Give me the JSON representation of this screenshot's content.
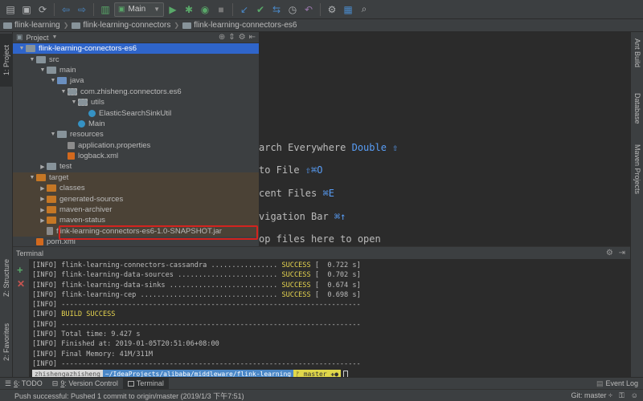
{
  "toolbar": {
    "run_config": "Main",
    "icons": [
      "open-icon",
      "save-icon",
      "sync-icon",
      "back-icon",
      "forward-icon",
      "build-icon",
      "run-icon",
      "debug-icon",
      "coverage-icon",
      "stop-icon",
      "vcs-update-icon",
      "vcs-commit-icon",
      "vcs-compare-icon",
      "vcs-history-icon",
      "vcs-revert-icon",
      "settings-icon",
      "project-structure-icon",
      "search-icon"
    ]
  },
  "breadcrumb": {
    "items": [
      "flink-learning",
      "flink-learning-connectors",
      "flink-learning-connectors-es6"
    ]
  },
  "left_tabs": {
    "project": "1: Project",
    "structure": "Z: Structure",
    "favorites": "2: Favorites"
  },
  "right_tabs": {
    "ant": "Ant Build",
    "database": "Database",
    "maven": "Maven Projects"
  },
  "project_panel": {
    "title": "Project",
    "tree": [
      {
        "label": "flink-learning-connectors-es6",
        "level": 0,
        "icon": "folder",
        "open": true,
        "selected": true
      },
      {
        "label": "src",
        "level": 1,
        "icon": "folder",
        "open": true
      },
      {
        "label": "main",
        "level": 2,
        "icon": "folder",
        "open": true
      },
      {
        "label": "java",
        "level": 3,
        "icon": "src",
        "open": true
      },
      {
        "label": "com.zhisheng.connectors.es6",
        "level": 4,
        "icon": "pkg",
        "open": true
      },
      {
        "label": "utils",
        "level": 5,
        "icon": "pkg",
        "open": true
      },
      {
        "label": "ElasticSearchSinkUtil",
        "level": 6,
        "icon": "cls",
        "leaf": true
      },
      {
        "label": "Main",
        "level": 5,
        "icon": "cls",
        "leaf": true
      },
      {
        "label": "resources",
        "level": 3,
        "icon": "folder",
        "open": true
      },
      {
        "label": "application.properties",
        "level": 4,
        "icon": "props",
        "leaf": true
      },
      {
        "label": "logback.xml",
        "level": 4,
        "icon": "xml",
        "leaf": true
      },
      {
        "label": "test",
        "level": 2,
        "icon": "folder",
        "open": false
      },
      {
        "label": "target",
        "level": 1,
        "icon": "orange",
        "open": true,
        "excluded": true
      },
      {
        "label": "classes",
        "level": 2,
        "icon": "orange",
        "open": false,
        "excluded": true
      },
      {
        "label": "generated-sources",
        "level": 2,
        "icon": "orange",
        "open": false,
        "excluded": true
      },
      {
        "label": "maven-archiver",
        "level": 2,
        "icon": "orange",
        "open": false,
        "excluded": true
      },
      {
        "label": "maven-status",
        "level": 2,
        "icon": "orange",
        "open": false,
        "excluded": true
      },
      {
        "label": "flink-learning-connectors-es6-1.0-SNAPSHOT.jar",
        "level": 2,
        "icon": "jar",
        "leaf": true,
        "excluded": true
      },
      {
        "label": "pom.xml",
        "level": 1,
        "icon": "xml",
        "leaf": true
      }
    ]
  },
  "editor_hints": [
    {
      "text": "arch Everywhere ",
      "key": "Double ⇧"
    },
    {
      "text": " to File ",
      "key": "⇧⌘O"
    },
    {
      "text": "cent Files ",
      "key": "⌘E"
    },
    {
      "text": "vigation Bar ",
      "key": "⌘↑"
    },
    {
      "text": "op files here to open",
      "key": ""
    }
  ],
  "terminal": {
    "title": "Terminal",
    "lines": [
      {
        "text": "[INFO] flink-learning-connectors-cassandra ................ ",
        "status": "SUCCESS",
        "tail": " [  0.722 s]"
      },
      {
        "text": "[INFO] flink-learning-data-sources ........................ ",
        "status": "SUCCESS",
        "tail": " [  0.702 s]"
      },
      {
        "text": "[INFO] flink-learning-data-sinks .......................... ",
        "status": "SUCCESS",
        "tail": " [  0.674 s]"
      },
      {
        "text": "[INFO] flink-learning-cep ................................. ",
        "status": "SUCCESS",
        "tail": " [  0.698 s]"
      },
      {
        "text": "[INFO] ------------------------------------------------------------------------",
        "status": "",
        "tail": ""
      },
      {
        "text": "[INFO] ",
        "status": "BUILD SUCCESS",
        "tail": ""
      },
      {
        "text": "[INFO] ------------------------------------------------------------------------",
        "status": "",
        "tail": ""
      },
      {
        "text": "[INFO] Total time: 9.427 s",
        "status": "",
        "tail": ""
      },
      {
        "text": "[INFO] Finished at: 2019-01-05T20:51:06+08:00",
        "status": "",
        "tail": ""
      },
      {
        "text": "[INFO] Final Memory: 41M/311M",
        "status": "",
        "tail": ""
      },
      {
        "text": "[INFO] ------------------------------------------------------------------------",
        "status": "",
        "tail": ""
      }
    ],
    "prompt_user": "zhishengazhisheng",
    "prompt_path": "~/IdeaProjects/alibaba/middleware/flink-learning",
    "prompt_git": "ᚠ master ✚●"
  },
  "bottom_tabs": {
    "todo_num": "6",
    "todo": ": TODO",
    "vc_num": "9",
    "vc": ": Version Control",
    "terminal": "Terminal",
    "event_log": "Event Log"
  },
  "status_bar": {
    "message": "Push successful: Pushed 1 commit to origin/master (2019/1/3 下午7:51)",
    "git": "Git: master ÷"
  }
}
